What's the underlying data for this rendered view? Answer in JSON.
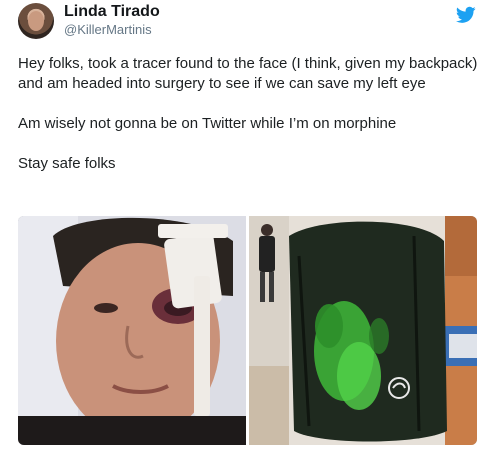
{
  "author": {
    "display_name": "Linda Tirado",
    "handle": "@KillerMartinis"
  },
  "brand": {
    "icon": "twitter-bird-icon",
    "color": "#1da1f2"
  },
  "tweet": {
    "paragraphs": [
      "Hey folks, took a tracer found to the face (I think, given my backpack) and am headed into surgery to see if we can save my left eye",
      "Am wisely not gonna be on Twitter while I’m on morphine",
      "Stay safe folks"
    ]
  },
  "media": {
    "count": 2
  }
}
